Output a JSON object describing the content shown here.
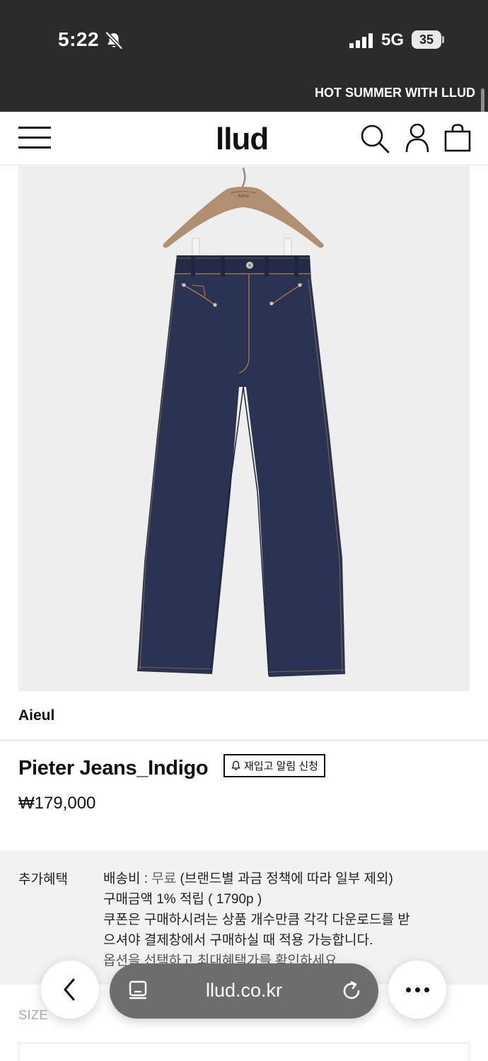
{
  "status_bar": {
    "time": "5:22",
    "network": "5G",
    "battery": "35",
    "icons": [
      "bell-muted-icon",
      "signal-icon",
      "battery-icon"
    ]
  },
  "marquee": {
    "text": "HOT SUMMER WITH LLUD"
  },
  "header": {
    "logo": "llud",
    "icons": [
      "menu-icon",
      "search-icon",
      "account-icon",
      "bag-icon"
    ]
  },
  "product": {
    "image": "product-photo-indigo-jeans",
    "brand": "Aieul",
    "title": "Pieter Jeans_Indigo",
    "restock_label": "재입고 알림 신청",
    "price": "₩179,000"
  },
  "benefits": {
    "label": "추가혜택",
    "shipping_prefix": "배송비 : ",
    "shipping_value": "무료",
    "shipping_note": " (브랜드별 과금 정책에 따라 일부 제외)",
    "points": "구매금액 1% 적립 ( 1790p )",
    "coupon_line1": "쿠폰은 구매하시려는 상품 개수만큼 각각 다운로드를 받",
    "coupon_line2": "으셔야 결제창에서 구매하실 때 적용 가능합니다.",
    "option_line": "옵션을 선택하고 최대혜택가를 확인하세요."
  },
  "size": {
    "label": "SIZE"
  },
  "browser": {
    "url": "llud.co.kr",
    "icons": [
      "chevron-left-icon",
      "reader-icon",
      "reload-icon",
      "more-icon"
    ]
  },
  "colors": {
    "topbar": "#2b2b2b",
    "image_bg": "#eeeeee",
    "denim": "#2a3352",
    "benefits_bg": "#f2f2f2",
    "pill": "#6d6d6d"
  }
}
